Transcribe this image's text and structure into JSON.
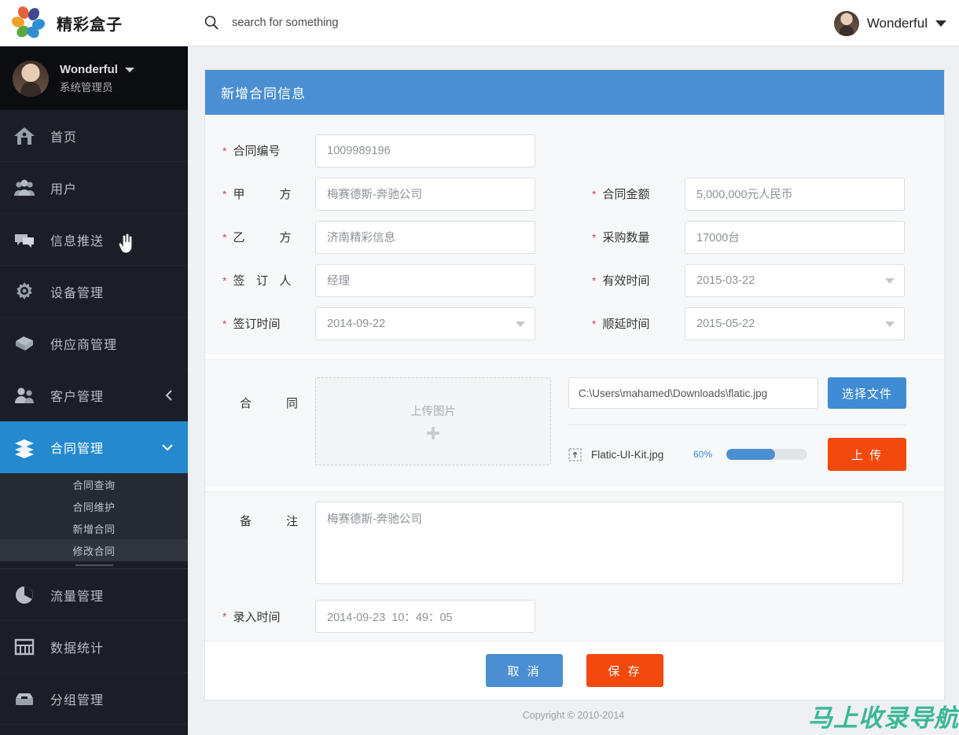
{
  "topbar": {
    "brand_name": "精彩盒子",
    "logo_icon": "flower-logo-icon",
    "search_icon": "search-icon",
    "search_placeholder": "search for something",
    "search_value": "",
    "user_name": "Wonderful",
    "user_caret_icon": "chevron-down-icon",
    "avatar_icon": "user-avatar"
  },
  "sidebar": {
    "user_name": "Wonderful",
    "user_role": "系统管理员",
    "user_caret_icon": "chevron-down-icon",
    "items": [
      {
        "label": "首页",
        "icon": "home-icon",
        "active": false
      },
      {
        "label": "用户",
        "icon": "users-icon",
        "active": false
      },
      {
        "label": "信息推送",
        "icon": "chat-icon",
        "active": false
      },
      {
        "label": "设备管理",
        "icon": "gear-icon",
        "active": false
      },
      {
        "label": "供应商管理",
        "icon": "box-icon",
        "active": false
      },
      {
        "label": "客户管理",
        "icon": "customers-icon",
        "active": false,
        "arrow": "chevron-left-icon"
      },
      {
        "label": "合同管理",
        "icon": "layers-icon",
        "active": true,
        "arrow": "chevron-down-icon"
      }
    ],
    "submenu": [
      {
        "label": "合同查询",
        "current": false
      },
      {
        "label": "合同维护",
        "current": false
      },
      {
        "label": "新增合同",
        "current": false
      },
      {
        "label": "修改合同",
        "current": true
      }
    ],
    "items_bottom": [
      {
        "label": "流量管理",
        "icon": "pie-chart-icon",
        "active": false
      },
      {
        "label": "数据统计",
        "icon": "abacus-icon",
        "active": false
      },
      {
        "label": "分组管理",
        "icon": "archive-icon",
        "active": false
      }
    ]
  },
  "form": {
    "title": "新增合同信息",
    "fields": {
      "contract_no": {
        "label": "合同编号",
        "value": "1009989196",
        "required": true
      },
      "party_a": {
        "label_chars": [
          "甲",
          "方"
        ],
        "value": "梅赛德斯-奔驰公司",
        "required": true
      },
      "party_b": {
        "label_chars": [
          "乙",
          "方"
        ],
        "value": "济南精彩信息",
        "required": true
      },
      "signer": {
        "label_chars": [
          "签",
          "订",
          "人"
        ],
        "value": "经理",
        "required": true
      },
      "sign_date": {
        "label": "签订时间",
        "value": "2014-09-22",
        "required": true,
        "caret_icon": "chevron-down-icon"
      },
      "amount": {
        "label": "合同金额",
        "value": "5,000,000元人民币",
        "required": true
      },
      "quantity": {
        "label": "采购数量",
        "value": "17000台",
        "required": true
      },
      "valid_date": {
        "label": "有效时间",
        "value": "2015-03-22",
        "required": true,
        "caret_icon": "chevron-down-icon"
      },
      "extend_date": {
        "label": "顺延时间",
        "value": "2015-05-22",
        "required": true,
        "caret_icon": "chevron-down-icon"
      },
      "remark": {
        "label_chars": [
          "备",
          "注"
        ],
        "value": "梅赛德斯-奔驰公司",
        "required": false
      },
      "entry_time": {
        "label": "录入时间",
        "value": "2014-09-23  10：49：05",
        "required": true
      }
    },
    "upload": {
      "label_chars": [
        "合",
        "同"
      ],
      "dropzone_text": "上传图片",
      "plus_icon": "plus-icon",
      "file_path": "C:\\Users\\mahamed\\Downloads\\flatic.jpg",
      "choose_button": "选择文件",
      "file_icon": "upload-file-icon",
      "file_name": "Flatic-UI-Kit.jpg",
      "progress_pct": "60%",
      "progress_value": 60,
      "upload_button": "上 传"
    },
    "cancel_button": "取 消",
    "save_button": "保 存"
  },
  "footer": {
    "copyright": "Copyright © 2010-2014",
    "watermark": "马上收录导航"
  },
  "colors": {
    "accent_blue": "#2489ce",
    "panel_header_blue": "#4b8ed1",
    "orange": "#f2490c",
    "sidebar_dark": "#1b1e26",
    "watermark_teal": "#3bb797"
  }
}
